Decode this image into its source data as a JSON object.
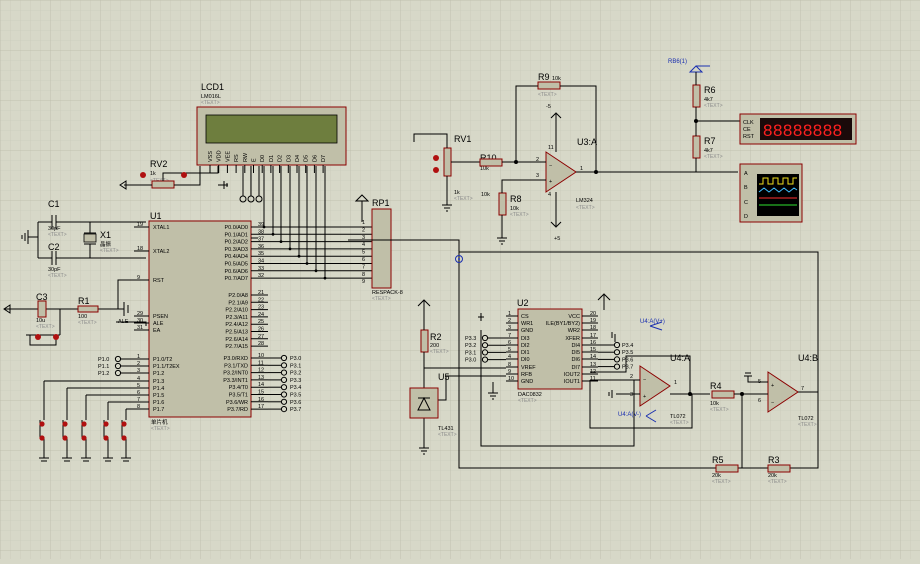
{
  "colors": {
    "background": "#d7d8c8",
    "grid": "#c9cab9",
    "component_body": "#c0bfa8",
    "component_border": "#8b0000",
    "wire": "#000000",
    "lcd_screen": "#6e7e3e",
    "counter_screen": "#1a0a0a",
    "counter_digits": "#ff2020",
    "scope_screen": "#000000",
    "label_blue": "#1a2fb0",
    "pin_red": "#b01010"
  },
  "placeholder": "<TEXT>",
  "lcd": {
    "ref": "LCD1",
    "model": "LM016L",
    "pins": [
      "VSS",
      "VDD",
      "VEE",
      "RS",
      "RW",
      "E",
      "D0",
      "D1",
      "D2",
      "D3",
      "D4",
      "D5",
      "D6",
      "D7"
    ]
  },
  "u1": {
    "ref": "U1",
    "name": "单片机",
    "left_pins": [
      {
        "n": "19",
        "l": "XTAL1"
      },
      {
        "n": "18",
        "l": "XTAL2"
      },
      {
        "n": "9",
        "l": "RST"
      },
      {
        "n": "29",
        "l": "PSEN"
      },
      {
        "n": "30",
        "l": "ALE"
      },
      {
        "n": "31",
        "l": "EA"
      },
      {
        "n": "1",
        "l": "P1.0/T2"
      },
      {
        "n": "2",
        "l": "P1.1/T2EX"
      },
      {
        "n": "3",
        "l": "P1.2"
      },
      {
        "n": "4",
        "l": "P1.3"
      },
      {
        "n": "5",
        "l": "P1.4"
      },
      {
        "n": "6",
        "l": "P1.5"
      },
      {
        "n": "7",
        "l": "P1.6"
      },
      {
        "n": "8",
        "l": "P1.7"
      }
    ],
    "right_pins": [
      {
        "n": "39",
        "l": "P0.0/AD0"
      },
      {
        "n": "38",
        "l": "P0.1/AD1"
      },
      {
        "n": "37",
        "l": "P0.2/AD2"
      },
      {
        "n": "36",
        "l": "P0.3/AD3"
      },
      {
        "n": "35",
        "l": "P0.4/AD4"
      },
      {
        "n": "34",
        "l": "P0.5/AD5"
      },
      {
        "n": "33",
        "l": "P0.6/AD6"
      },
      {
        "n": "32",
        "l": "P0.7/AD7"
      },
      {
        "n": "21",
        "l": "P2.0/A8"
      },
      {
        "n": "22",
        "l": "P2.1/A9"
      },
      {
        "n": "23",
        "l": "P2.2/A10"
      },
      {
        "n": "24",
        "l": "P2.3/A11"
      },
      {
        "n": "25",
        "l": "P2.4/A12"
      },
      {
        "n": "26",
        "l": "P2.5/A13"
      },
      {
        "n": "27",
        "l": "P2.6/A14"
      },
      {
        "n": "28",
        "l": "P2.7/A15"
      },
      {
        "n": "10",
        "l": "P3.0/RXD"
      },
      {
        "n": "11",
        "l": "P3.1/TXD"
      },
      {
        "n": "12",
        "l": "P3.2/INT0"
      },
      {
        "n": "13",
        "l": "P3.3/INT1"
      },
      {
        "n": "14",
        "l": "P3.4/T0"
      },
      {
        "n": "15",
        "l": "P3.5/T1"
      },
      {
        "n": "16",
        "l": "P3.6/WR"
      },
      {
        "n": "17",
        "l": "P3.7/RD"
      }
    ],
    "p1_terminals": [
      "P1.0",
      "P1.1",
      "P1.2"
    ],
    "p3_terminals": [
      "P3.0",
      "P3.1",
      "P3.2",
      "P3.3",
      "P3.4",
      "P3.5",
      "P3.6",
      "P3.7"
    ],
    "ale": "ALE"
  },
  "rp1": {
    "ref": "RP1",
    "model": "RESPACK-8",
    "pins": [
      "1",
      "2",
      "3",
      "4",
      "5",
      "6",
      "7",
      "8",
      "9"
    ]
  },
  "c1": {
    "ref": "C1",
    "value": "30pF"
  },
  "c2": {
    "ref": "C2",
    "value": "30pF"
  },
  "c3": {
    "ref": "C3",
    "value": "10u"
  },
  "x1": {
    "ref": "X1",
    "value": "晶振"
  },
  "r1": {
    "ref": "R1",
    "value": "100"
  },
  "rv2": {
    "ref": "RV2",
    "value": "1k"
  },
  "rv1": {
    "ref": "RV1",
    "value": "1k"
  },
  "r10": {
    "ref": "R10",
    "value": "10k"
  },
  "r9": {
    "ref": "R9",
    "value": "10k"
  },
  "r8": {
    "ref": "R8",
    "value": "10k"
  },
  "r6": {
    "ref": "R6",
    "value": "4k7"
  },
  "r7": {
    "ref": "R7",
    "value": "4k7"
  },
  "rb6": {
    "label": "RB6(1)"
  },
  "u3a": {
    "ref": "U3:A",
    "model": "LM324",
    "pins": [
      "2",
      "3",
      "1",
      "4",
      "11"
    ],
    "rail_top": "-5",
    "rail_bot": "+5"
  },
  "counter": {
    "pins": [
      "CLK",
      "CE",
      "RST"
    ],
    "display": "88888888"
  },
  "scope": {
    "channels": [
      "A",
      "B",
      "C",
      "D"
    ]
  },
  "u2": {
    "ref": "U2",
    "model": "DAC0832",
    "left_pins": [
      {
        "n": "1",
        "l": "CS"
      },
      {
        "n": "2",
        "l": "WR1"
      },
      {
        "n": "3",
        "l": "GND"
      },
      {
        "n": "7",
        "l": "DI3"
      },
      {
        "n": "6",
        "l": "DI2"
      },
      {
        "n": "5",
        "l": "DI1"
      },
      {
        "n": "4",
        "l": "DI0"
      },
      {
        "n": "8",
        "l": "VREF"
      },
      {
        "n": "9",
        "l": "RFB"
      },
      {
        "n": "10",
        "l": "GND"
      }
    ],
    "right_pins": [
      {
        "n": "20",
        "l": "VCC"
      },
      {
        "n": "19",
        "l": "ILE(BY1/BY2)"
      },
      {
        "n": "18",
        "l": "WR2"
      },
      {
        "n": "17",
        "l": "XFER"
      },
      {
        "n": "16",
        "l": "DI4"
      },
      {
        "n": "15",
        "l": "DI5"
      },
      {
        "n": "14",
        "l": "DI6"
      },
      {
        "n": "13",
        "l": "DI7"
      },
      {
        "n": "12",
        "l": "IOUT2"
      },
      {
        "n": "11",
        "l": "IOUT1"
      }
    ],
    "left_terms": [
      "P3.3",
      "P3.2",
      "P3.1",
      "P3.0"
    ],
    "right_terms": [
      "P3.4",
      "P3.5",
      "P3.6",
      "P3.7"
    ]
  },
  "r2": {
    "ref": "R2",
    "value": "200"
  },
  "u5": {
    "ref": "U5",
    "model": "TL431"
  },
  "u4a": {
    "ref": "U4:A",
    "model": "TL072",
    "pins": [
      "2",
      "3",
      "1"
    ],
    "vp": "U4:A(V+)",
    "vn": "U4:A(V-)"
  },
  "u4b": {
    "ref": "U4:B",
    "model": "TL072",
    "pins": [
      "6",
      "5",
      "7"
    ]
  },
  "r4": {
    "ref": "R4",
    "value": "10k"
  },
  "r5": {
    "ref": "R5",
    "value": "20k"
  },
  "r3": {
    "ref": "R3",
    "value": "20k"
  }
}
